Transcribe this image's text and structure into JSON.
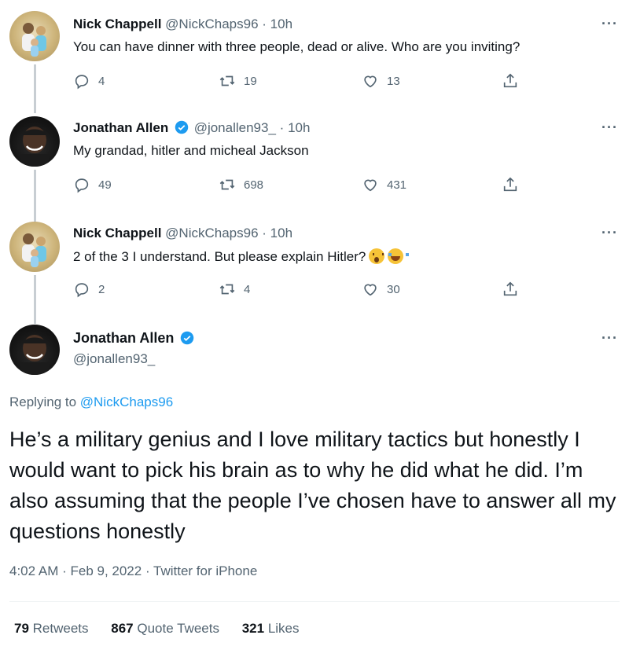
{
  "tweets": [
    {
      "name": "Nick Chappell",
      "handle": "@NickChaps96",
      "time": "10h",
      "text": "You can have dinner with three people, dead or alive. Who are you inviting?",
      "replies": "4",
      "retweets": "19",
      "likes": "13"
    },
    {
      "name": "Jonathan Allen",
      "handle": "@jonallen93_",
      "time": "10h",
      "text": "My grandad, hitler and micheal Jackson",
      "replies": "49",
      "retweets": "698",
      "likes": "431"
    },
    {
      "name": "Nick Chappell",
      "handle": "@NickChaps96",
      "time": "10h",
      "text": "2 of the 3 I understand. But please explain Hitler?",
      "replies": "2",
      "retweets": "4",
      "likes": "30"
    }
  ],
  "main": {
    "name": "Jonathan Allen",
    "handle": "@jonallen93_",
    "replying_prefix": "Replying to",
    "replying_to": "@NickChaps96",
    "text": "He’s a military genius and I love military tactics but honestly I would want to pick his brain as to why he did what he did. I’m also assuming that the people I’ve chosen have to answer all my questions honestly",
    "meta": "4:02 AM · Feb 9, 2022 · Twitter for iPhone",
    "stats": {
      "retweets_num": "79",
      "retweets_label": "Retweets",
      "quotes_num": "867",
      "quotes_label": "Quote Tweets",
      "likes_num": "321",
      "likes_label": "Likes"
    }
  },
  "separator": "·",
  "more_label": "···",
  "icons": {
    "reply": "reply-icon",
    "retweet": "retweet-icon",
    "like": "heart-icon",
    "share": "share-icon",
    "verified": "verified-badge-icon",
    "more": "more-options-icon"
  },
  "colors": {
    "verified": "#1d9bf0",
    "link": "#1d9bf0",
    "secondary": "#536471",
    "primary": "#0f1419"
  }
}
